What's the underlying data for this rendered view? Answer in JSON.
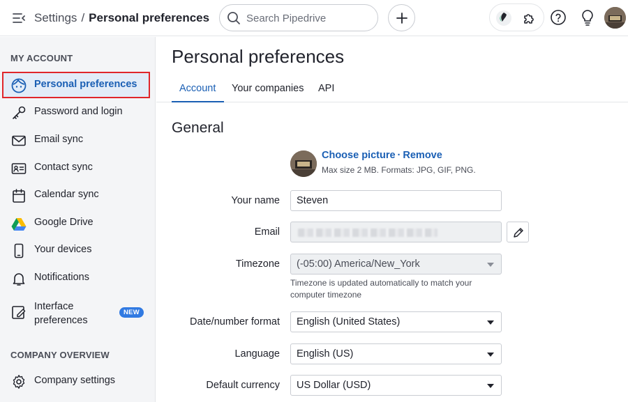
{
  "header": {
    "breadcrumb_root": "Settings",
    "breadcrumb_sep": "/",
    "breadcrumb_current": "Personal preferences",
    "search_placeholder": "Search Pipedrive"
  },
  "sidebar": {
    "section_account": "MY ACCOUNT",
    "section_company": "COMPANY OVERVIEW",
    "items": [
      {
        "label": "Personal preferences",
        "icon": "user-face-icon",
        "active": true
      },
      {
        "label": "Password and login",
        "icon": "key-icon"
      },
      {
        "label": "Email sync",
        "icon": "envelope-icon"
      },
      {
        "label": "Contact sync",
        "icon": "contact-card-icon"
      },
      {
        "label": "Calendar sync",
        "icon": "calendar-icon"
      },
      {
        "label": "Google Drive",
        "icon": "google-drive-icon"
      },
      {
        "label": "Your devices",
        "icon": "phone-icon"
      },
      {
        "label": "Notifications",
        "icon": "bell-icon"
      },
      {
        "label": "Interface preferences",
        "icon": "interface-edit-icon",
        "badge": "NEW"
      },
      {
        "label": "Company settings",
        "icon": "gear-icon"
      }
    ]
  },
  "main": {
    "title": "Personal preferences",
    "tabs": [
      {
        "label": "Account",
        "active": true
      },
      {
        "label": "Your companies"
      },
      {
        "label": "API"
      }
    ],
    "section_title": "General",
    "picture": {
      "choose_label": "Choose picture",
      "separator": "·",
      "remove_label": "Remove",
      "hint": "Max size 2 MB. Formats: JPG, GIF, PNG."
    },
    "fields": {
      "name_label": "Your name",
      "name_value": "Steven",
      "email_label": "Email",
      "timezone_label": "Timezone",
      "timezone_value": "(-05:00) America/New_York",
      "timezone_help": "Timezone is updated automatically to match your computer timezone",
      "date_label": "Date/number format",
      "date_value": "English (United States)",
      "language_label": "Language",
      "language_value": "English (US)",
      "currency_label": "Default currency",
      "currency_value": "US Dollar (USD)"
    }
  },
  "colors": {
    "accent": "#1a5fb4",
    "active_outline": "#e0262b",
    "badge": "#317ae2"
  }
}
